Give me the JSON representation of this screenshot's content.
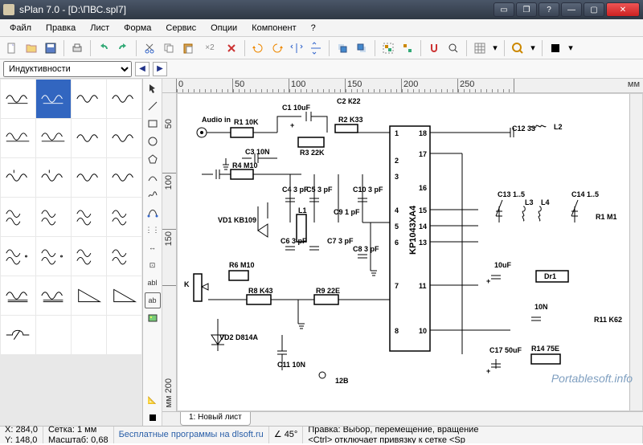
{
  "window": {
    "title": "sPlan 7.0 - [D:\\ПВС.spl7]"
  },
  "menu": [
    "Файл",
    "Правка",
    "Лист",
    "Форма",
    "Сервис",
    "Опции",
    "Компонент",
    "?"
  ],
  "library_selected": "Индуктивности",
  "ruler": {
    "h": [
      "0",
      "50",
      "100",
      "150",
      "200",
      "250"
    ],
    "v": [
      "50",
      "100",
      "150"
    ],
    "unit_h": "мм",
    "unit_v": "мм 200"
  },
  "sheet_tab": "1: Новый лист",
  "status": {
    "x": "X: 284,0",
    "y": "Y: 148,0",
    "grid": "Сетка: 1 мм",
    "scale": "Масштаб:  0,68",
    "snap_angle": "45°",
    "hint1": "Правка: Выбор, перемещение, вращение",
    "hint2": "<Ctrl> отключает привязку к сетке <Sp",
    "download": "Бесплатные программы на dlsoft.ru"
  },
  "labels": {
    "audio_in": "Audio in",
    "r1": "R1 10K",
    "c1": "C1 10uF",
    "c2_r22": "С2 К22",
    "r2": "R2 K33",
    "c3": "С3 10N",
    "r3": "R3 22K",
    "r4": "R4 M10",
    "c4": "С4\n3 pF",
    "c5": "C5\n3 pF",
    "c10": "C10\n3 pF",
    "vd1": "VD1\nKB109",
    "l1": "L1",
    "c6": "С6\n3 pF",
    "c7": "C7\n3 pF",
    "c9": "C9\n1 pF",
    "c8": "С8\n3 pF",
    "r6": "R6\nM10",
    "r8": "R8 K43",
    "r9": "R9 22E",
    "vd2": "VD2\nD814A",
    "c11": "C11\n10N",
    "v12b": "12B",
    "c12": "C12\n33",
    "l2": "L2",
    "c13": "C13\n1..5",
    "l3": "L3",
    "l4": "L4",
    "c14": "C14\n1..5",
    "r1b": "R1\nM1",
    "dr1": "Dr1",
    "u10uf": "10uF",
    "u10n": "10N",
    "r11": "R11\nK62",
    "c17": "C17\n50uF",
    "r14": "R14 75E",
    "ic": "KP1043XA4",
    "pins_left": [
      "1",
      "2",
      "3",
      "4",
      "5",
      "6",
      "7",
      "8"
    ],
    "pins_right": [
      "18",
      "17",
      "16",
      "15",
      "14",
      "13",
      "11",
      "10"
    ],
    "k": "K"
  },
  "watermark": "Portablesoft.info"
}
